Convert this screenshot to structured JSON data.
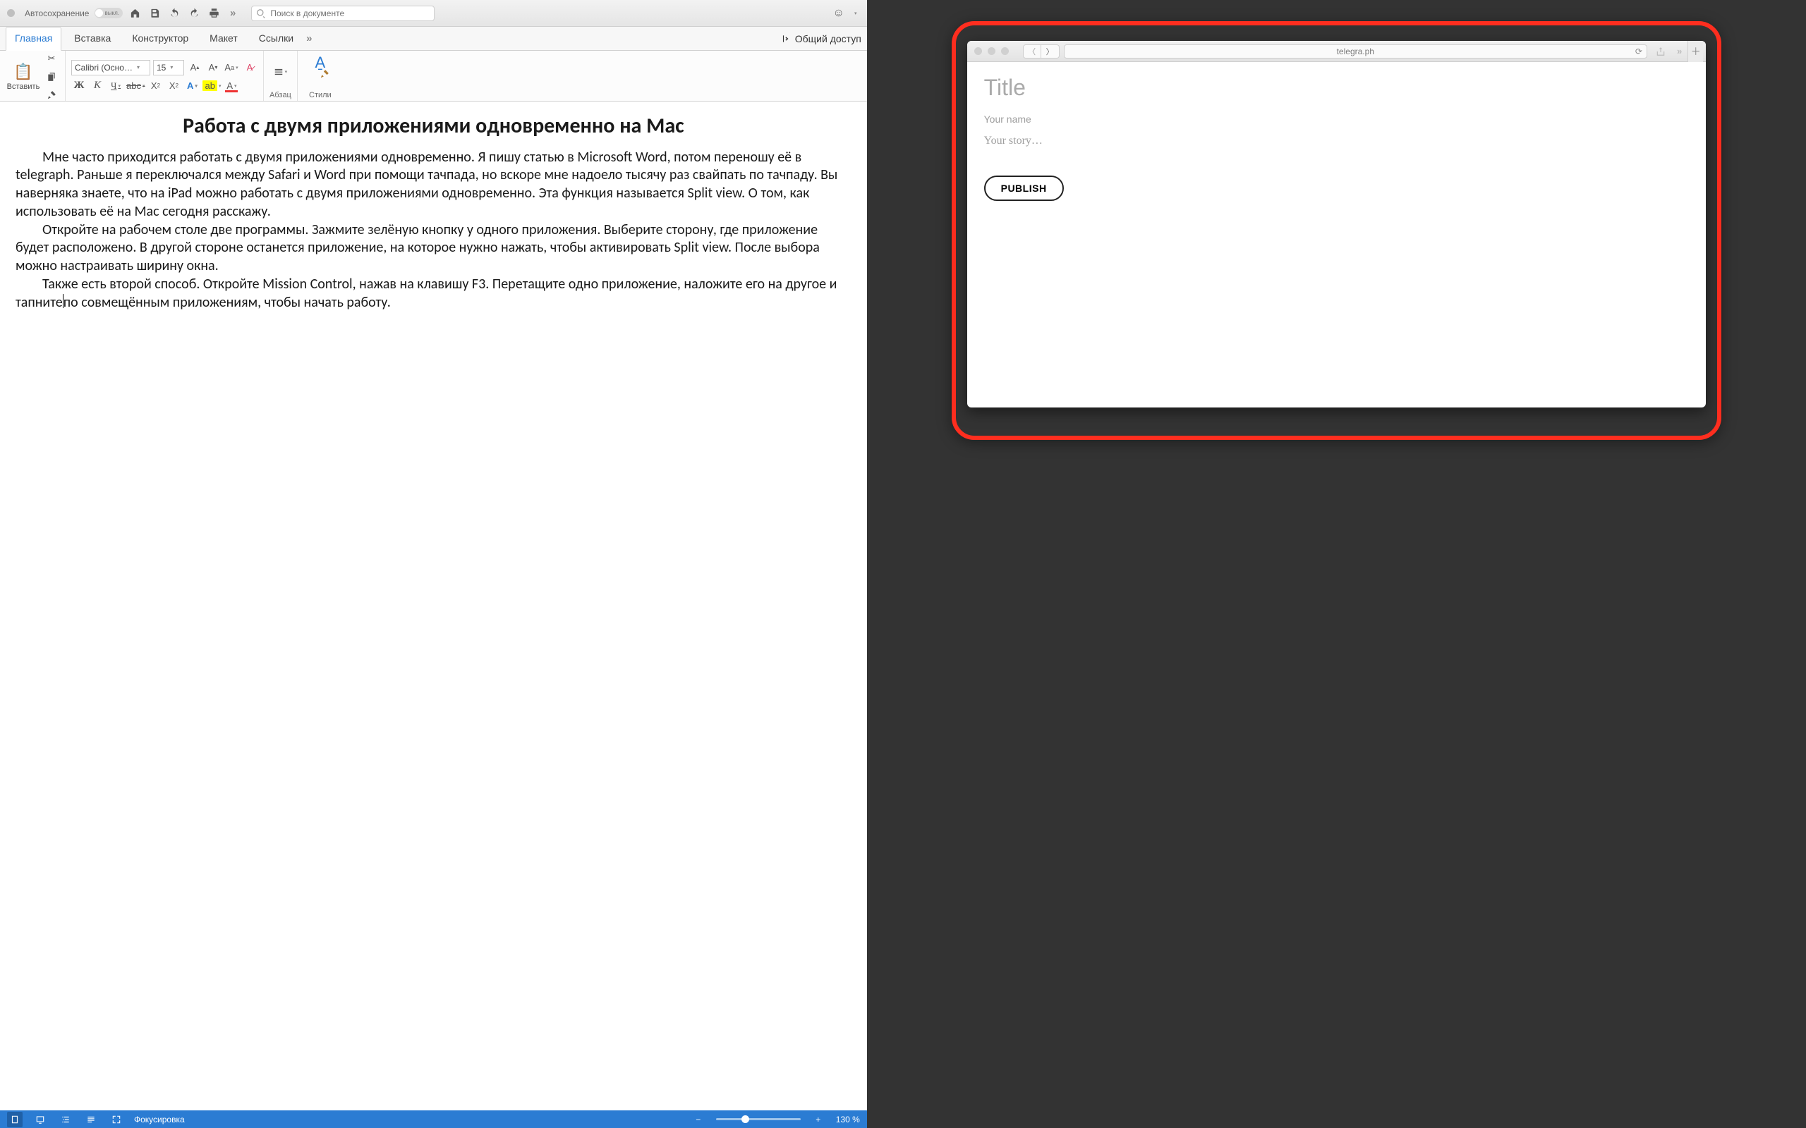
{
  "word": {
    "titlebar": {
      "autosave_label": "Автосохранение",
      "autosave_state": "выкл.",
      "search_placeholder": "Поиск в документе"
    },
    "ribbon_tabs": {
      "home": "Главная",
      "insert": "Вставка",
      "design": "Конструктор",
      "layout": "Макет",
      "references": "Ссылки",
      "share": "Общий доступ"
    },
    "ribbon": {
      "paste": "Вставить",
      "font_name": "Calibri (Осно…",
      "font_size": "15",
      "paragraph": "Абзац",
      "styles": "Стили"
    },
    "document": {
      "heading": "Работа с двумя приложениями одновременно на Mac",
      "p1": "Мне часто приходится работать с двумя приложениями одновременно. Я пишу статью в Microsoft Word, потом переношу её в telegraph. Раньше я переключался между Safari и Word при помощи тачпада, но вскоре мне надоело тысячу раз свайпать по тачпаду. Вы наверняка знаете, что на iPad можно работать с двумя приложениями одновременно. Эта функция называется Split view. О том, как использовать её на Mac сегодня расскажу.",
      "p2": "Откройте на рабочем столе две программы. Зажмите зелёную кнопку у одного приложения. Выберите сторону, где приложение будет расположено. В другой стороне останется приложение, на которое нужно нажать, чтобы активировать Split view. После выбора можно настраивать ширину окна.",
      "p3a": "Также есть второй способ. Откройте Mission Control, нажав на клавишу F3. Перетащите одно приложение, наложите его на другое и тапните",
      "p3b": "по совмещённым приложениям, чтобы начать работу."
    },
    "status": {
      "focus": "Фокусировка",
      "zoom": "130 %"
    }
  },
  "safari": {
    "address": "telegra.ph",
    "page": {
      "title_placeholder": "Title",
      "name_placeholder": "Your name",
      "body_placeholder": "Your story…",
      "publish": "PUBLISH"
    }
  }
}
